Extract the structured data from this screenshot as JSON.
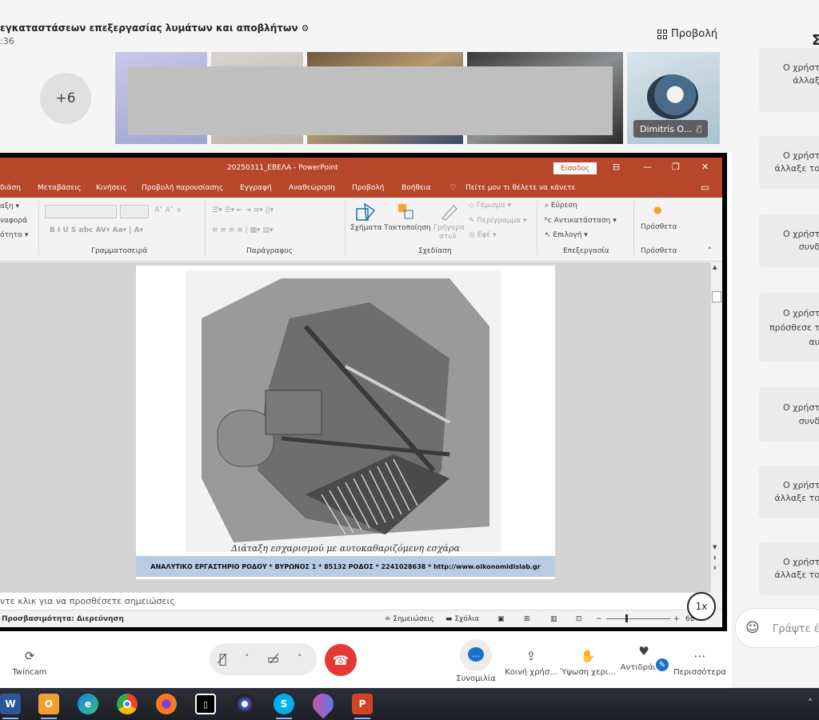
{
  "meeting": {
    "title": "εγκαταστάσεων επεξεργασίας λυμάτων και αποβλήτων",
    "time": ":36",
    "view_label": "Προβολή",
    "overflow_count": "+6",
    "participant_name": "Dimitris O..."
  },
  "ppt": {
    "doc_title": "20250311_ΕΒΕΛΑ  -  PowerPoint",
    "signin": "Είσοδος",
    "menu": [
      "διάση",
      "Μεταβάσεις",
      "Κινήσεις",
      "Προβολή παρουσίασης",
      "Εγγραφή",
      "Αναθεώρηση",
      "Προβολή",
      "Βοήθεια",
      "Πείτε μου τι θέλετε να κάνετε"
    ],
    "ribbon": {
      "left_items": [
        "αξη ▾",
        "ναφορά",
        "ότητα ▾"
      ],
      "groups": [
        "Γραμματοσειρά",
        "Παράγραφος",
        "Σχεδίαση",
        "Επεξεργασία",
        "Πρόσθετα"
      ],
      "shapes": "Σχήματα",
      "arrange": "Τακτοποίηση",
      "quick_styles": "Γρήγορα στυλ",
      "fill": "Γέμισμα",
      "outline": "Περίγραμμα",
      "effects": "Εφέ",
      "find": "Εύρεση",
      "replace": "Αντικατάσταση",
      "select": "Επιλογή",
      "addins": "Πρόσθετα"
    },
    "slide": {
      "caption": "Διάταξη εσχαρισμού με αυτοκαθαριζόμενη εσχάρα",
      "footer": "ΑΝΑΛΥΤΙΚΟ ΕΡΓΑΣΤΗΡΙΟ ΡΟΔΟΥ * ΒΥΡΩΝΟΣ 1 * 85132 ΡΟΔΟΣ * 2241028638  * http://www.oikonomidislab.gr"
    },
    "notes_placeholder": "ντε κλικ για να προσθέσετε σημειώσεις",
    "status": {
      "accessibility": "Προσβασιμότητα: Διερεύνηση",
      "notes": "Σημειώσεις",
      "comments": "Σχόλια",
      "zoom": "68%"
    },
    "playback_speed": "1x"
  },
  "controls": {
    "twincam": "Twincam",
    "chat": "Συνομιλία",
    "share": "Κοινή χρήσ...",
    "raise_hand": "Ύψωση χερι...",
    "react": "Αντιδράστε",
    "more": "Περισσότερα"
  },
  "chat_panel": {
    "header": "Σ",
    "messages": [
      [
        "Ο χρήστ",
        "άλλαξ"
      ],
      [
        "Ο χρήστ",
        "άλλαξε το"
      ],
      [
        "Ο χρήστ",
        "συνδ"
      ],
      [
        "Ο χρήστ",
        "πρόσθεσε τ",
        "αυ"
      ],
      [
        "Ο χρήστ",
        "συνδ"
      ],
      [
        "Ο χρήστ",
        "άλλαξε το"
      ],
      [
        "Ο χρήστ",
        "άλλαξε το"
      ]
    ],
    "compose_placeholder": "Γράψτε έ"
  },
  "taskbar": {
    "apps": [
      "word",
      "outlook",
      "edge",
      "chrome",
      "firefox",
      "whiteboard",
      "obs",
      "skype",
      "droplet",
      "powerpoint"
    ]
  },
  "colors": {
    "ppt_red": "#b7472a",
    "hangup_red": "#e53935",
    "teams_blue": "#1a73c8",
    "footer_band": "#b8cce4"
  }
}
